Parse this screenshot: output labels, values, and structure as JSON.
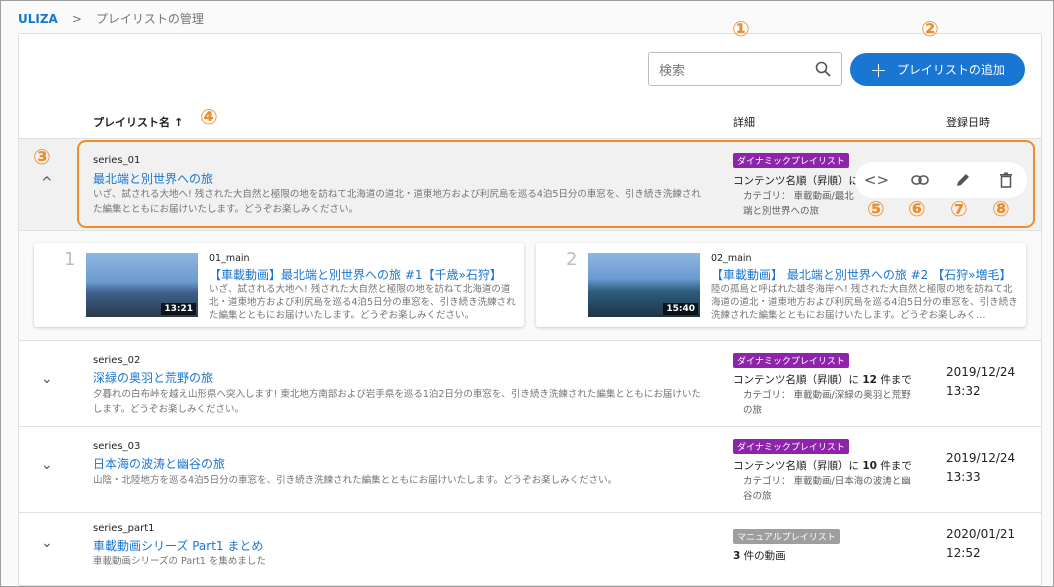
{
  "breadcrumb": {
    "home": "ULIZA",
    "sep": ">",
    "current": "プレイリストの管理"
  },
  "search": {
    "placeholder": "検索"
  },
  "add_button": {
    "label": "プレイリストの追加"
  },
  "headers": {
    "name": "プレイリスト名",
    "sort_arrow": "↑",
    "detail": "詳細",
    "date": "登録日時"
  },
  "callouts": [
    "①",
    "②",
    "③",
    "④",
    "⑤",
    "⑥",
    "⑦",
    "⑧"
  ],
  "actions": [
    {
      "icon": "code-icon",
      "glyph": "<>"
    },
    {
      "icon": "link-icon",
      "glyph": "⊂⊃"
    },
    {
      "icon": "pencil-icon",
      "glyph": "✎"
    },
    {
      "icon": "trash-icon",
      "glyph": "🗑"
    }
  ],
  "rows": [
    {
      "id": "series_01",
      "title": "最北端と別世界への旅",
      "desc": "いざ、試される大地へ! 残された大自然と極限の地を訪ねて北海道の道北・道東地方および利尻島を巡る4泊5日分の車窓を、引き続き洗練された編集とともにお届けいたします。どうぞお楽しみください。",
      "badge": "ダイナミックプレイリスト",
      "sort": "コンテンツ名順（昇順）に",
      "category": "カテゴリ： 車載動画/最北端と別世界への旅",
      "chevron": "^"
    },
    {
      "id": "series_02",
      "title": "深緑の奥羽と荒野の旅",
      "desc": "夕暮れの白布峠を越え山形県へ突入します! 東北地方南部および岩手県を巡る1泊2日分の車窓を、引き続き洗練された編集とともにお届けいたします。どうぞお楽しみください。",
      "badge": "ダイナミックプレイリスト",
      "sort_pre": "コンテンツ名順（昇順）に",
      "sort_count": "12",
      "sort_post": "件まで",
      "category": "カテゴリ： 車載動画/深緑の奥羽と荒野の旅",
      "date": "2019/12/24",
      "time": "13:32",
      "chevron": "⌄"
    },
    {
      "id": "series_03",
      "title": "日本海の波涛と幽谷の旅",
      "desc": "山陰・北陸地方を巡る4泊5日分の車窓を、引き続き洗練された編集とともにお届けいたします。どうぞお楽しみください。",
      "badge": "ダイナミックプレイリスト",
      "sort_pre": "コンテンツ名順（昇順）に",
      "sort_count": "10",
      "sort_post": "件まで",
      "category": "カテゴリ： 車載動画/日本海の波涛と幽谷の旅",
      "date": "2019/12/24",
      "time": "13:33",
      "chevron": "⌄"
    },
    {
      "id": "series_part1",
      "title": "車載動画シリーズ Part1 まとめ",
      "desc": "車載動画シリーズの Part1 を集めました",
      "badge": "マニュアルプレイリスト",
      "count_pre": "3",
      "count_post": "件の動画",
      "date": "2020/01/21",
      "time": "12:52",
      "chevron": "⌄"
    }
  ],
  "videos": [
    {
      "num": "1",
      "id": "01_main",
      "title": "【車載動画】最北端と別世界への旅 #1【千歳»石狩】",
      "desc": "いざ、試される大地へ! 残された大自然と極限の地を訪ねて北海道の道北・道東地方および利尻島を巡る4泊5日分の車窓を、引き続き洗練された編集とともにお届けいたします。どうぞお楽しみください。",
      "duration": "13:21"
    },
    {
      "num": "2",
      "id": "02_main",
      "title": "【車載動画】 最北端と別世界への旅 #2 【石狩»増毛】",
      "desc": "陸の孤島と呼ばれた雄冬海岸へ! 残された大自然と極限の地を訪ねて北海道の道北・道東地方および利尻島を巡る4泊5日分の車窓を、引き続き洗練された編集とともにお届けいたします。どうぞお楽しみく…",
      "duration": "15:40"
    }
  ],
  "colors": {
    "accent": "#1976d2",
    "callout": "#f28c28",
    "dynamic_badge": "#8e24aa",
    "manual_badge": "#9e9e9e"
  }
}
